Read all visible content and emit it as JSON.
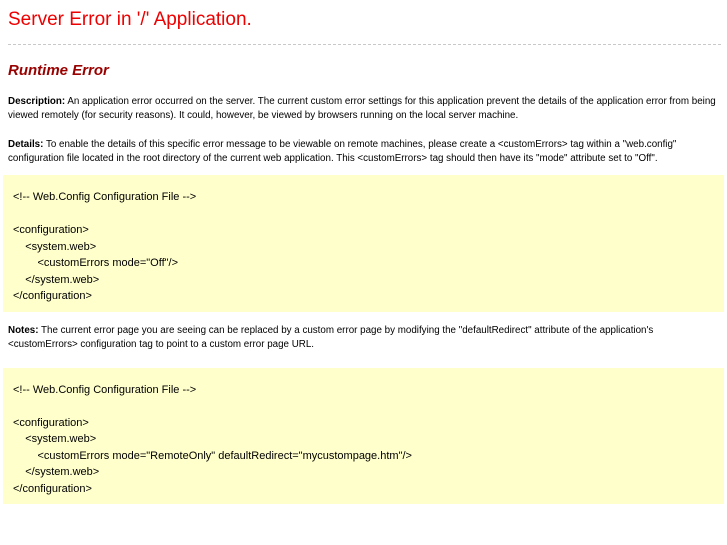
{
  "page": {
    "title": "Server Error in '/' Application.",
    "subtitle": "Runtime Error"
  },
  "paragraphs": {
    "description_label": "Description:",
    "description_text": "An application error occurred on the server. The current custom error settings for this application prevent the details of the application error from being viewed remotely (for security reasons). It could, however, be viewed by browsers running on the local server machine.",
    "details_label": "Details:",
    "details_text": "To enable the details of this specific error message to be viewable on remote machines, please create a <customErrors> tag within a \"web.config\" configuration file located in the root directory of the current web application. This <customErrors> tag should then have its \"mode\" attribute set to \"Off\".",
    "notes_label": "Notes:",
    "notes_text": "The current error page you are seeing can be replaced by a custom error page by modifying the \"defaultRedirect\" attribute of the application's <customErrors> configuration tag to point to a custom error page URL."
  },
  "code_blocks": [
    {
      "name": "web-config-custom-errors-off",
      "code": "<!-- Web.Config Configuration File -->\n\n<configuration>\n    <system.web>\n        <customErrors mode=\"Off\"/>\n    </system.web>\n</configuration>"
    },
    {
      "name": "web-config-custom-errors-remoteonly",
      "code": "<!-- Web.Config Configuration File -->\n\n<configuration>\n    <system.web>\n        <customErrors mode=\"RemoteOnly\" defaultRedirect=\"mycustompage.htm\"/>\n    </system.web>\n</configuration>"
    }
  ],
  "colors": {
    "title_red": "#ee0000",
    "subtitle_maroon": "#990000",
    "code_background": "#ffffcc",
    "divider_gray": "#c9c9c9",
    "body_text": "#000000",
    "page_background": "#ffffff"
  }
}
